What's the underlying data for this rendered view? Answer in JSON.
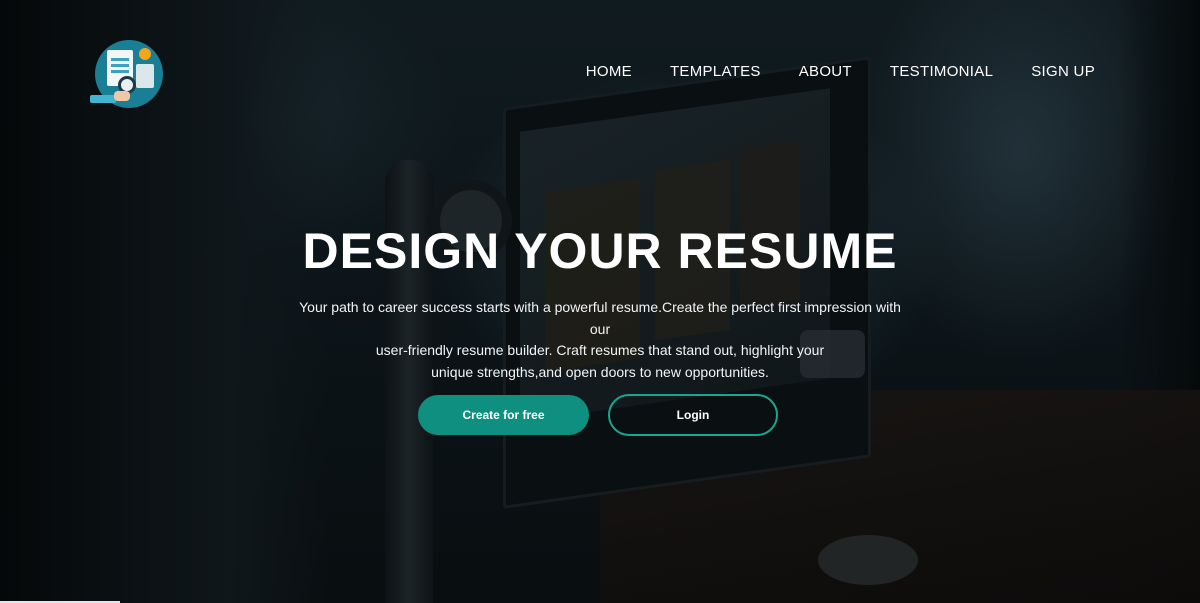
{
  "nav": {
    "items": [
      {
        "label": "HOME"
      },
      {
        "label": "TEMPLATES"
      },
      {
        "label": "ABOUT"
      },
      {
        "label": "TESTIMONIAL"
      },
      {
        "label": "SIGN UP"
      }
    ]
  },
  "hero": {
    "title": "DESIGN YOUR RESUME",
    "text_lines": [
      "Your path to career success starts with a powerful resume.Create the perfect first impression with our",
      "user-friendly resume builder. Craft resumes that stand out, highlight your",
      "unique strengths,and open doors to new opportunities."
    ],
    "primary_button": "Create for free",
    "secondary_button": "Login"
  },
  "theme": {
    "accent": "#0e8f80",
    "outline": "#19a690",
    "logo_color": "#1a7f95",
    "logo_icon": "resume-analytics-logo"
  }
}
